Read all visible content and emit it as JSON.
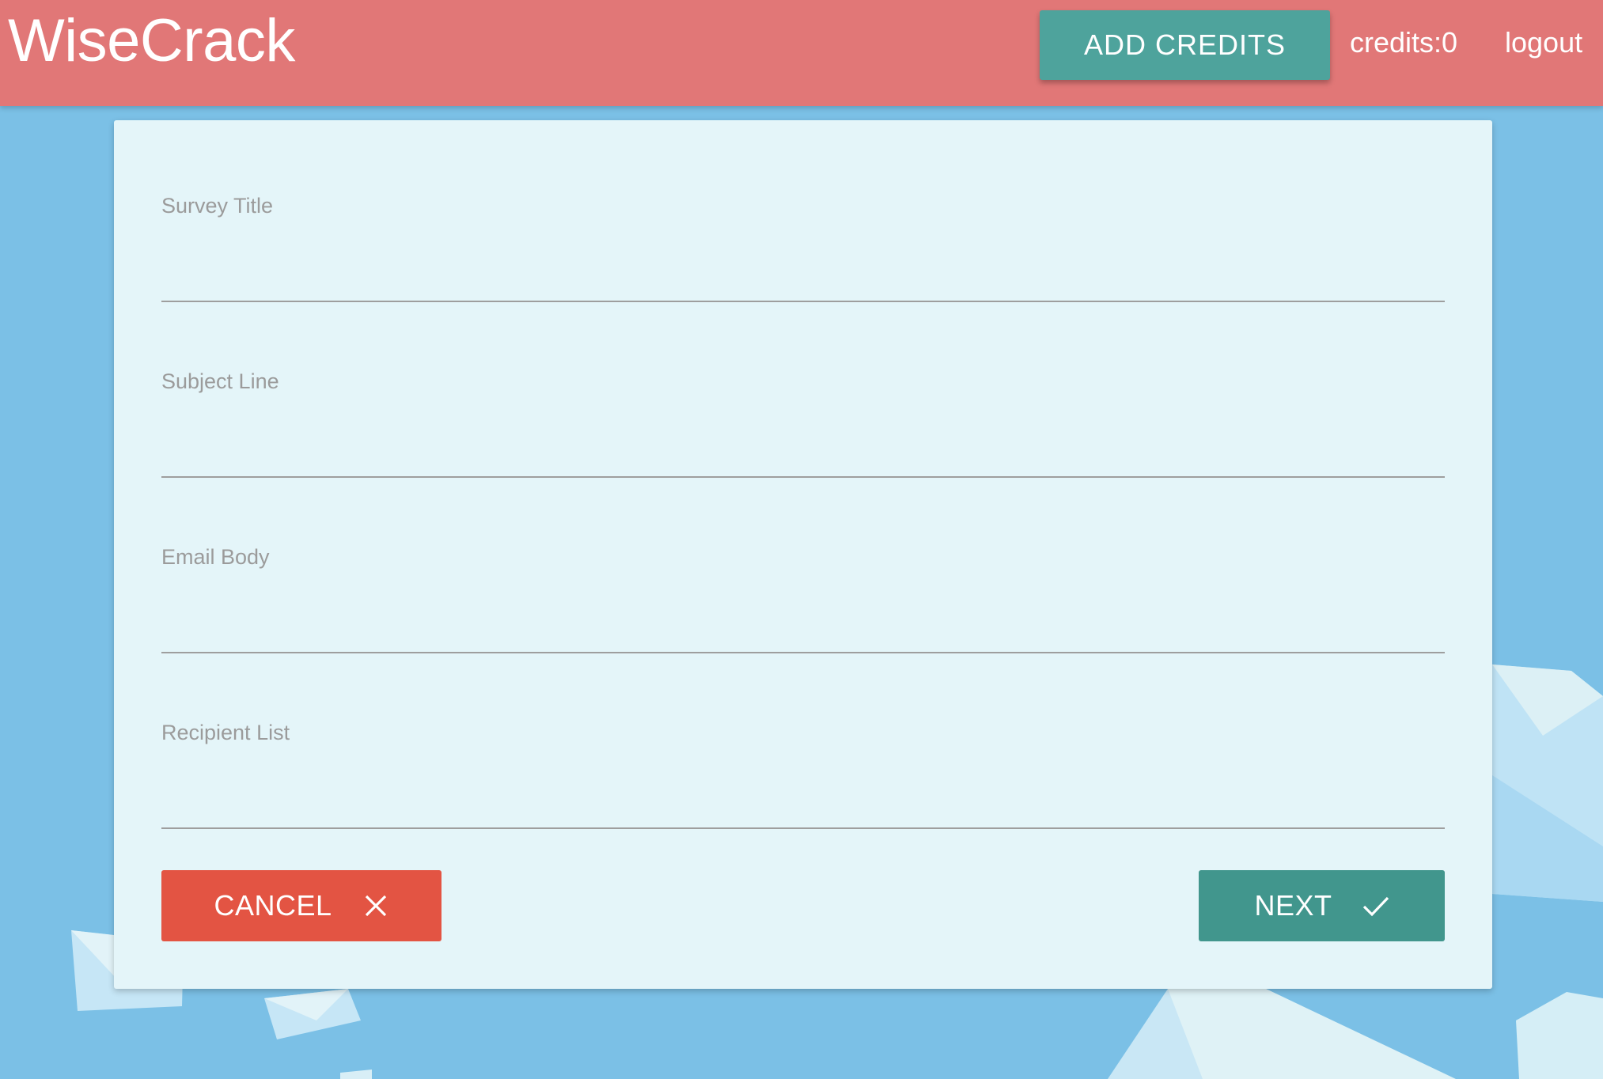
{
  "app": {
    "brand": "WiseCrack"
  },
  "header": {
    "add_credits_label": "ADD CREDITS",
    "credits_text": "credits:0",
    "logout_label": "logout"
  },
  "form": {
    "fields": [
      {
        "label": "Survey Title",
        "value": ""
      },
      {
        "label": "Subject Line",
        "value": ""
      },
      {
        "label": "Email Body",
        "value": ""
      },
      {
        "label": "Recipient List",
        "value": ""
      }
    ],
    "cancel_label": "CANCEL",
    "cancel_icon": "close-icon",
    "next_label": "NEXT",
    "next_icon": "check-icon"
  },
  "colors": {
    "navbar": "#e17777",
    "accent": "#4ea39c",
    "background": "#7bc0e6",
    "card": "#e4f5f9",
    "cancel": "#e35443",
    "next": "#41968d"
  }
}
